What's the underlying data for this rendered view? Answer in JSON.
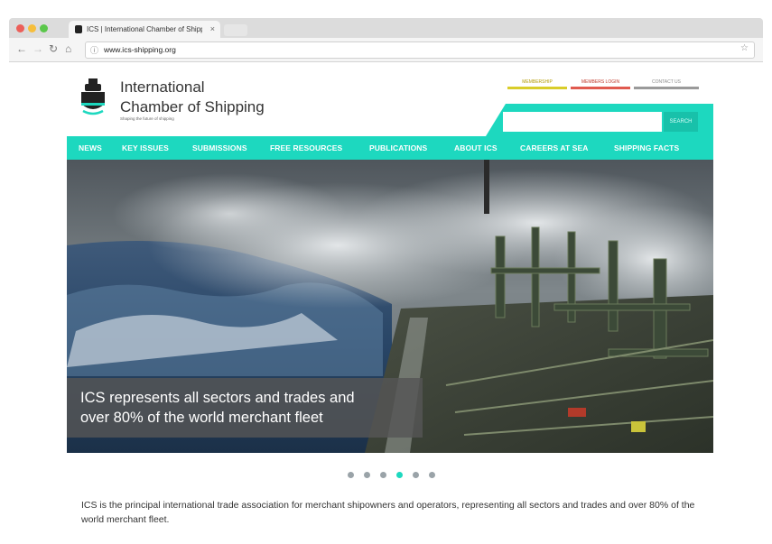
{
  "browser": {
    "tab_title": "ICS | International Chamber of Shipping",
    "tab_close": "×",
    "url": "www.ics-shipping.org",
    "info_glyph": "ⓘ",
    "star_glyph": "☆",
    "back_glyph": "←",
    "forward_glyph": "→",
    "reload_glyph": "↻",
    "home_glyph": "⌂"
  },
  "header": {
    "org_name_line1": "International",
    "org_name_line2": "Chamber of Shipping",
    "tagline": "Shaping the future of shipping",
    "logo_icon": "ship-bow-icon"
  },
  "util_links": {
    "membership": "MEMBERSHIP",
    "members_login": "MEMBERS LOGIN",
    "contact": "CONTACT US"
  },
  "search": {
    "placeholder": "",
    "button_label": "SEARCH"
  },
  "nav": {
    "items": [
      {
        "label": "NEWS"
      },
      {
        "label": "KEY ISSUES"
      },
      {
        "label": "SUBMISSIONS"
      },
      {
        "label": "FREE RESOURCES"
      },
      {
        "label": "PUBLICATIONS"
      },
      {
        "label": "ABOUT ICS"
      },
      {
        "label": "CAREERS AT SEA"
      },
      {
        "label": "SHIPPING FACTS"
      }
    ]
  },
  "hero": {
    "caption_line1": "ICS represents all sectors and trades and",
    "caption_line2": "over 80% of the world merchant fleet",
    "slide_count": 6,
    "active_slide": 4
  },
  "intro": {
    "text": "ICS is the principal international trade association for merchant shipowners and operators, representing all sectors and trades and over 80% of the world merchant fleet."
  },
  "colors": {
    "accent": "#1dd8bf",
    "membership": "#d9cd2a",
    "login": "#e05a4f",
    "contact": "#9a9a9a"
  }
}
